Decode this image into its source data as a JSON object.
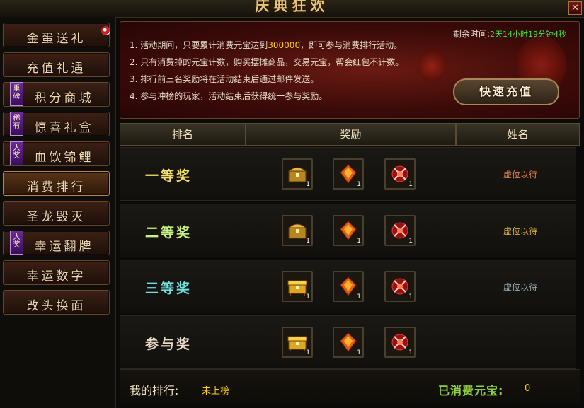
{
  "window": {
    "title": "庆典狂欢",
    "close_label": "✕"
  },
  "sidebar": {
    "items": [
      {
        "label": "金蛋送礼",
        "tag": "",
        "badge": "notify-dot"
      },
      {
        "label": "充值礼遇",
        "tag": ""
      },
      {
        "label": "积分商城",
        "tag": "重磅"
      },
      {
        "label": "惊喜礼盒",
        "tag": "稀有"
      },
      {
        "label": "血饮锦鲤",
        "tag": "大奖"
      },
      {
        "label": "消费排行",
        "tag": "",
        "active": true
      },
      {
        "label": "圣龙毁灭",
        "tag": ""
      },
      {
        "label": "幸运翻牌",
        "tag": "大奖"
      },
      {
        "label": "幸运数字",
        "tag": ""
      },
      {
        "label": "改头换面",
        "tag": ""
      }
    ]
  },
  "banner": {
    "rules": {
      "r1_pre": "1. 活动期间，只要累计消费元宝达到",
      "r1_amount": "300000",
      "r1_post": "，即可参与消费排行活动。",
      "r2": "2. 只有消费掉的元宝计数，购买摆摊商品，交易元宝，帮会红包不计数。",
      "r3": "3. 排行前三名奖励将在活动结束后通过邮件发送。",
      "r4": "4. 参与冲榜的玩家，活动结束后获得统一参与奖励。"
    },
    "timer_label": "剩余时间:",
    "timer_value": "2天14小时19分钟4秒",
    "recharge_button": "快速充值"
  },
  "table": {
    "headers": {
      "rank": "排名",
      "reward": "奖励",
      "name": "姓名"
    },
    "rows": [
      {
        "prize": "一等奖",
        "prize_color": "#f4e070",
        "items": [
          {
            "icon": "gold-treasure-chest-icon",
            "count": "1"
          },
          {
            "icon": "fire-gem-icon",
            "count": "1"
          },
          {
            "icon": "red-rune-crystal-icon",
            "count": "1"
          }
        ],
        "player": "虚位以待",
        "player_color": "#e08050"
      },
      {
        "prize": "二等奖",
        "prize_color": "#c8f080",
        "items": [
          {
            "icon": "gold-treasure-chest-icon",
            "count": "1"
          },
          {
            "icon": "fire-gem-icon",
            "count": "1"
          },
          {
            "icon": "red-rune-crystal-icon",
            "count": "1"
          }
        ],
        "player": "虚位以待",
        "player_color": "#d8b040"
      },
      {
        "prize": "三等奖",
        "prize_color": "#70e0e0",
        "items": [
          {
            "icon": "golden-chest-icon",
            "count": "1"
          },
          {
            "icon": "fire-gem-icon",
            "count": "1"
          },
          {
            "icon": "red-rune-crystal-icon",
            "count": "1"
          }
        ],
        "player": "虚位以待",
        "player_color": "#98a8b0"
      },
      {
        "prize": "参与奖",
        "prize_color": "#e8dcc8",
        "items": [
          {
            "icon": "golden-chest-icon",
            "count": "1"
          },
          {
            "icon": "fire-gem-icon",
            "count": "1"
          },
          {
            "icon": "red-rune-crystal-icon",
            "count": "1"
          }
        ],
        "player": "",
        "player_color": "#98a8b0"
      }
    ]
  },
  "footer": {
    "my_rank_label": "我的排行:",
    "my_rank_value": "未上榜",
    "spent_label": "已消费元宝:",
    "spent_value": "0"
  }
}
